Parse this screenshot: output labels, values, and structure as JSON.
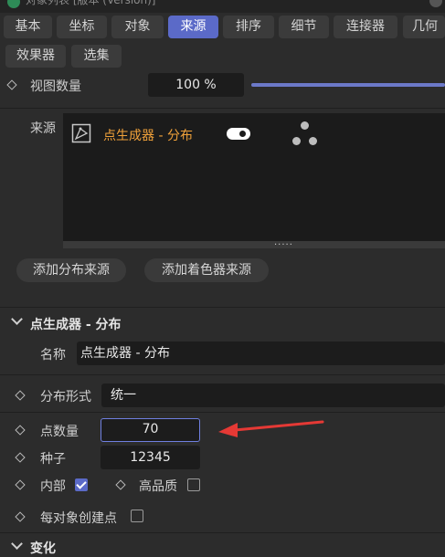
{
  "titlebar": {
    "text": "对象列表 [版本 (Version)]"
  },
  "tabs_row1": [
    "基本",
    "坐标",
    "对象",
    "来源",
    "排序",
    "细节",
    "连接器",
    "几何"
  ],
  "active_tab": "来源",
  "tabs_row2": [
    "效果器",
    "选集"
  ],
  "view_count": {
    "label": "视图数量",
    "value": "100 %"
  },
  "source": {
    "label": "来源",
    "items": [
      {
        "name": "点生成器 - 分布",
        "name_color": "#f0a13a",
        "enabled": true
      }
    ],
    "grip": "....."
  },
  "buttons": {
    "add_distribution": "添加分布来源",
    "add_shader": "添加着色器来源"
  },
  "section": {
    "title": "点生成器 - 分布"
  },
  "fields": {
    "name_label": "名称",
    "name_value": "点生成器 - 分布",
    "dist_label": "分布形式",
    "dist_value": "统一",
    "count_label": "点数量",
    "count_value": "70",
    "seed_label": "种子",
    "seed_value": "12345",
    "inside_label": "内部",
    "inside_checked": true,
    "hq_label": "高品质",
    "hq_checked": false,
    "per_obj_label": "每对象创建点",
    "per_obj_checked": false
  },
  "next_section": {
    "title": "变化"
  },
  "colors": {
    "accent": "#5b6ac8",
    "arrow": "#e53935",
    "source_name": "#f0a13a"
  }
}
